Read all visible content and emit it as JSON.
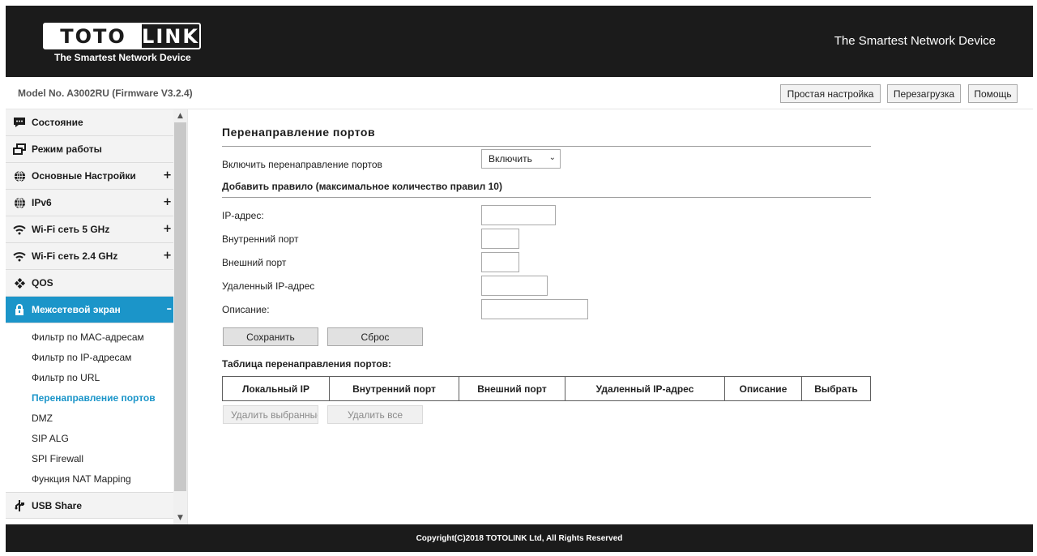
{
  "header": {
    "logo_left": "TOTO",
    "logo_right": "LINK",
    "logo_tagline": "The Smartest Network Device",
    "slogan": "The Smartest Network Device"
  },
  "topbar": {
    "model": "Model No. A3002RU (Firmware V3.2.4)",
    "buttons": [
      "Простая настройка",
      "Перезагрузка",
      "Помощь"
    ]
  },
  "sidebar": {
    "items": [
      {
        "label": "Состояние",
        "icon": "status-chat-icon"
      },
      {
        "label": "Режим работы",
        "icon": "windows-icon"
      },
      {
        "label": "Основные Настройки",
        "icon": "globe-icon",
        "expand": "+"
      },
      {
        "label": "IPv6",
        "icon": "globe-icon",
        "expand": "+"
      },
      {
        "label": "Wi-Fi сеть 5 GHz",
        "icon": "wifi-icon",
        "expand": "+"
      },
      {
        "label": "Wi-Fi сеть 2.4 GHz",
        "icon": "wifi-icon",
        "expand": "+"
      },
      {
        "label": "QOS",
        "icon": "qos-diamond-icon"
      },
      {
        "label": "Межсетевой экран",
        "icon": "lock-icon",
        "expand": "–"
      },
      {
        "label": "USB Share",
        "icon": "usb-icon"
      }
    ],
    "firewall_sub": [
      "Фильтр по MAC-адресам",
      "Фильтр по IP-адресам",
      "Фильтр по URL",
      "Перенаправление портов",
      "DMZ",
      "SIP ALG",
      "SPI Firewall",
      "Функция NAT Mapping"
    ],
    "current_sub": "Перенаправление портов"
  },
  "main": {
    "title": "Перенаправление портов",
    "enable_label": "Включить перенаправление портов",
    "enable_value": "Включить",
    "add_rule_label": "Добавить правило (максимальное количество правил 10)",
    "fields": {
      "ip": {
        "label": "IP-адрес:",
        "value": ""
      },
      "internal_port": {
        "label": "Внутренний порт",
        "value": ""
      },
      "external_port": {
        "label": "Внешний порт",
        "value": ""
      },
      "remote_ip": {
        "label": "Удаленный IP-адрес",
        "value": ""
      },
      "description": {
        "label": "Описание:",
        "value": ""
      }
    },
    "save_button": "Сохранить",
    "reset_button": "Сброс",
    "table_label": "Таблица перенаправления портов:",
    "table_headers": [
      "Локальный IP",
      "Внутренний порт",
      "Внешний порт",
      "Удаленный IP-адрес",
      "Описание",
      "Выбрать"
    ],
    "delete_selected": "Удалить выбранные",
    "delete_all": "Удалить все"
  },
  "footer": {
    "copyright": "Copyright(C)2018 TOTOLINK Ltd, All Rights Reserved"
  },
  "colors": {
    "header_bg": "#1b1b1b",
    "accent": "#1b95c9",
    "sidebar_bg": "#f3f3f3"
  }
}
